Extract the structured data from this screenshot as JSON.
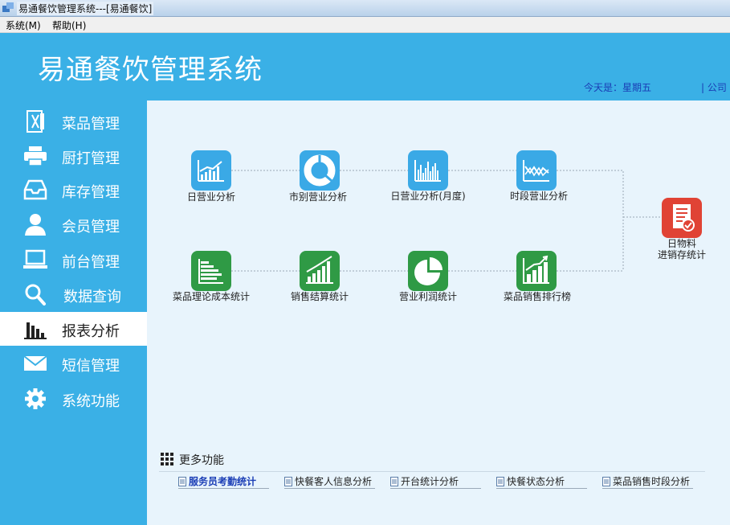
{
  "window": {
    "title": "易通餐饮管理系统---[易通餐饮]"
  },
  "menu": [
    {
      "label": "系统(M)"
    },
    {
      "label": "帮助(H)"
    }
  ],
  "header": {
    "app_title": "易通餐饮管理系统",
    "today": "今天是：星期五",
    "company": "| 公司"
  },
  "sidebar": {
    "active_index": 6,
    "items": [
      {
        "label": "菜品管理",
        "icon": "menu-card-icon"
      },
      {
        "label": "厨打管理",
        "icon": "printer-icon"
      },
      {
        "label": "库存管理",
        "icon": "inbox-icon"
      },
      {
        "label": "会员管理",
        "icon": "user-icon"
      },
      {
        "label": "前台管理",
        "icon": "laptop-icon"
      },
      {
        "label": "数据查询",
        "icon": "search-icon"
      },
      {
        "label": "报表分析",
        "icon": "bar-chart-icon"
      },
      {
        "label": "短信管理",
        "icon": "envelope-icon"
      },
      {
        "label": "系统功能",
        "icon": "gear-icon"
      }
    ]
  },
  "reports": {
    "row1": [
      {
        "label": "日营业分析",
        "icon": "rising-bar-chart-icon"
      },
      {
        "label": "市别营业分析",
        "icon": "donut-chart-icon"
      },
      {
        "label": "日营业分析(月度)",
        "icon": "histogram-icon"
      },
      {
        "label": "时段营业分析",
        "icon": "line-chart-icon"
      }
    ],
    "row2": [
      {
        "label": "菜品理论成本统计",
        "icon": "horizontal-bar-icon"
      },
      {
        "label": "销售结算统计",
        "icon": "growth-chart-icon"
      },
      {
        "label": "营业利润统计",
        "icon": "pie-chart-icon"
      },
      {
        "label": "菜品销售排行榜",
        "icon": "ranking-chart-icon"
      }
    ],
    "summary": {
      "label_line1": "日物料",
      "label_line2": "进销存统计",
      "icon": "checklist-icon"
    }
  },
  "more": {
    "title": "更多功能",
    "links": [
      {
        "label": "服务员考勤统计"
      },
      {
        "label": "快餐客人信息分析"
      },
      {
        "label": "开台统计分析"
      },
      {
        "label": "快餐状态分析"
      },
      {
        "label": "菜品销售时段分析"
      }
    ]
  },
  "colors": {
    "header_blue": "#3ab0e6",
    "tile_blue": "#3aa9e6",
    "tile_green": "#2f9a45",
    "tile_red": "#e04335",
    "link_blue": "#1a3db5"
  }
}
